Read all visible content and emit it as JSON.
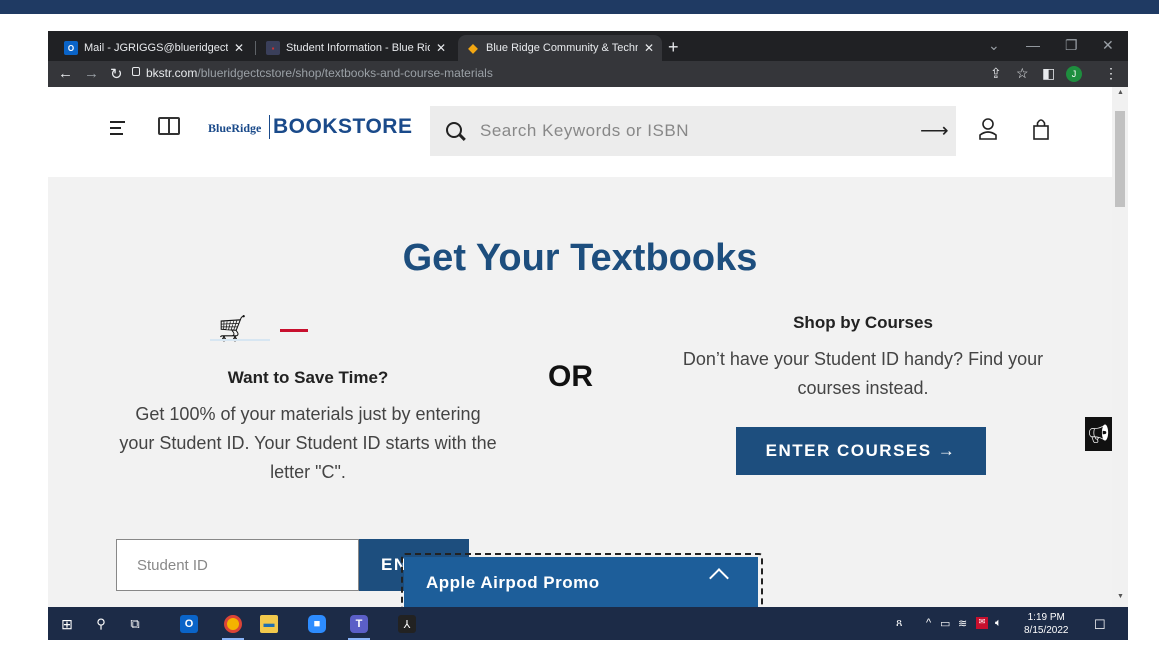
{
  "browser": {
    "tabs": [
      {
        "label": "Mail - JGRIGGS@blueridgectc.ed",
        "icon": "outlook-icon",
        "active": false
      },
      {
        "label": "Student Information - Blue Ridge",
        "icon": "brctc-icon",
        "active": false
      },
      {
        "label": "Blue Ridge Community & Technic",
        "icon": "bookstore-icon",
        "active": true
      }
    ],
    "new_tab": "+",
    "close_glyph": "✕",
    "url_domain": "bkstr.com",
    "url_path": "/blueridgectcstore/shop/textbooks-and-course-materials",
    "profile_initial": "J"
  },
  "header": {
    "logo_small": "BlueRidge",
    "logo_big": "BOOKSTORE",
    "search_placeholder": "Search Keywords or ISBN"
  },
  "hero": {
    "title": "Get Your Textbooks",
    "left_heading": "Want to Save Time?",
    "left_text": "Get 100% of your materials just by entering your Student ID. Your Student ID starts with the letter \"C\".",
    "or": "OR",
    "right_heading": "Shop by Courses",
    "right_text": "Don’t have your Student ID handy? Find your courses instead.",
    "enter_courses": "ENTER COURSES →",
    "student_id_placeholder": "Student ID",
    "enter_button": "EN"
  },
  "promo": {
    "label": "Apple Airpod Promo"
  },
  "taskbar": {
    "time": "1:19 PM",
    "date": "8/15/2022"
  }
}
